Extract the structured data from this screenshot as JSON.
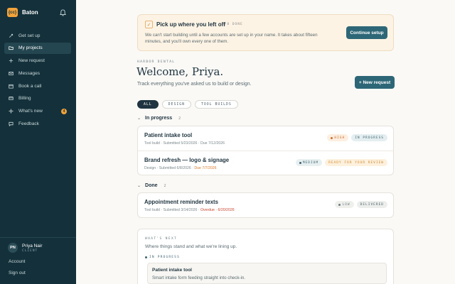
{
  "app": {
    "name": "Baton",
    "logo_text": "{cc}"
  },
  "sidebar": {
    "items": [
      {
        "label": "Get set up",
        "icon": "rocket-icon"
      },
      {
        "label": "My projects",
        "icon": "folder-icon",
        "active": true
      },
      {
        "label": "New request",
        "icon": "plus-icon"
      },
      {
        "label": "Messages",
        "icon": "mail-icon"
      },
      {
        "label": "Book a call",
        "icon": "calendar-icon"
      },
      {
        "label": "Billing",
        "icon": "card-icon"
      },
      {
        "label": "What's new",
        "icon": "sparkle-icon",
        "badge": "4"
      },
      {
        "label": "Feedback",
        "icon": "chat-icon"
      }
    ],
    "user": {
      "initials": "PN",
      "name": "Priya Nair",
      "role": "CLIENT"
    },
    "account_label": "Account",
    "signout_label": "Sign out"
  },
  "banner": {
    "title": "Pick up where you left off",
    "progress": "4/8 DONE",
    "text": "We can't start building until a few accounts are set up in your name. It takes about fifteen minutes, and you'll own every one of them.",
    "button": "Continue setup"
  },
  "header": {
    "org": "HARBOR DENTAL",
    "welcome": "Welcome, Priya.",
    "subtitle": "Track everything you've asked us to build or design.",
    "new_request": "+ New request"
  },
  "filters": [
    "ALL",
    "DESIGN",
    "TOOL BUILDS"
  ],
  "in_progress": {
    "title": "In progress",
    "count": "2",
    "rows": [
      {
        "title": "Patient intake tool",
        "meta": "Tool build · Submitted 5/23/2026 · Due 7/12/2026",
        "due": "",
        "priority": "HIGH",
        "status": "IN PROGRESS"
      },
      {
        "title": "Brand refresh — logo & signage",
        "meta": "Design · Submitted 6/8/2026 · ",
        "due": "Due 7/7/2026",
        "priority": "MEDIUM",
        "status": "READY FOR YOUR REVIEW"
      }
    ]
  },
  "done": {
    "title": "Done",
    "count": "2",
    "rows": [
      {
        "title": "Appointment reminder texts",
        "meta": "Tool build · Submitted 3/14/2026 · ",
        "overdue": "Overdue · 6/20/2026",
        "priority": "LOW",
        "status": "DELIVERED"
      }
    ]
  },
  "whats_next": {
    "label": "WHAT'S NEXT",
    "desc": "Where things stand and what we're lining up.",
    "sub_label": "IN PROGRESS",
    "item_title": "Patient intake tool",
    "item_desc": "Smart intake form feeding straight into check-in."
  },
  "colors": {
    "sidebar": "#14313b",
    "accent": "#2d6777",
    "orange": "#f2a33a",
    "banner_bg": "#fdf3e4"
  }
}
